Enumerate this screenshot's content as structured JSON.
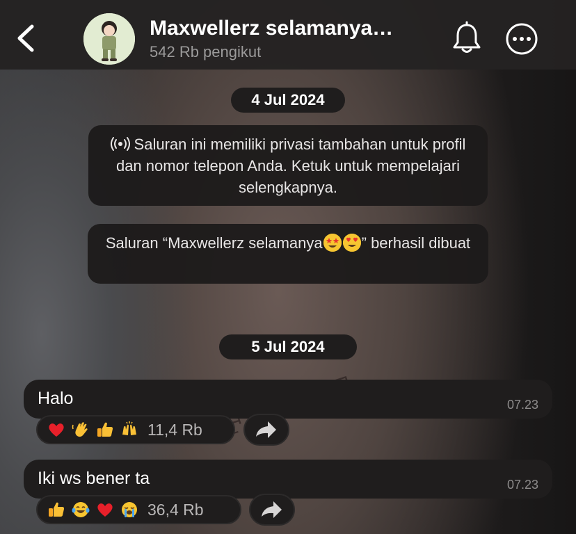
{
  "header": {
    "channel_name": "Maxwellerz selamanya…",
    "followers": "542 Rb pengikut"
  },
  "dates": [
    "4 Jul 2024",
    "5 Jul 2024"
  ],
  "notices": {
    "privacy": "Saluran ini memiliki privasi tambahan untuk profil dan nomor telepon Anda. Ketuk untuk mempelajari selengkapnya.",
    "created_prefix": "Saluran “Maxwellerz selamanya",
    "created_suffix": "” berhasil dibuat"
  },
  "messages": [
    {
      "text": "Halo",
      "time": "07.23",
      "reactions": [
        "heart",
        "waving-hand",
        "thumbs-up",
        "raising-hands"
      ],
      "reaction_count": "11,4 Rb"
    },
    {
      "text": "Iki ws bener ta",
      "time": "07.23",
      "reactions": [
        "thumbs-up",
        "laughing-tears",
        "heart",
        "loudly-crying"
      ],
      "reaction_count": "36,4 Rb"
    }
  ],
  "colors": {
    "header_bg": "#242222",
    "bubble_bg": "#1f1d1d",
    "muted_text": "#9b9a9a",
    "time_text": "#8e8c8c"
  }
}
